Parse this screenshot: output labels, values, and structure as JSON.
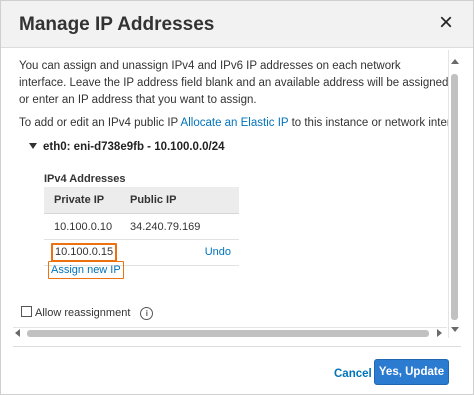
{
  "dialog": {
    "title": "Manage IP Addresses",
    "close_icon": "×"
  },
  "description": "You can assign and unassign IPv4 and IPv6 IP addresses on each network interface. Leave the IP address field blank and an available address will be assigned or enter an IP address that you want to assign.",
  "elastic": {
    "prefix": "To add or edit an IPv4 public IP ",
    "link": "Allocate an Elastic IP",
    "suffix": " to this instance or network interface."
  },
  "interface": {
    "label": "eth0: eni-d738e9fb - 10.100.0.0/24"
  },
  "ipv4": {
    "section_label": "IPv4 Addresses",
    "headers": [
      "Private IP",
      "Public IP"
    ],
    "rows": [
      {
        "private_ip": "10.100.0.10",
        "public_ip": "34.240.79.169"
      }
    ],
    "new_ip_value": "10.100.0.15",
    "undo_label": "Undo",
    "assign_label": "Assign new IP"
  },
  "allow_reassignment": {
    "label": "Allow reassignment",
    "checked": false,
    "info_icon": "i"
  },
  "footer": {
    "cancel_label": "Cancel",
    "update_label": "Yes, Update"
  },
  "colors": {
    "accent": "#2b7bd1",
    "link": "#0073bb",
    "highlight": "#ec7211"
  }
}
